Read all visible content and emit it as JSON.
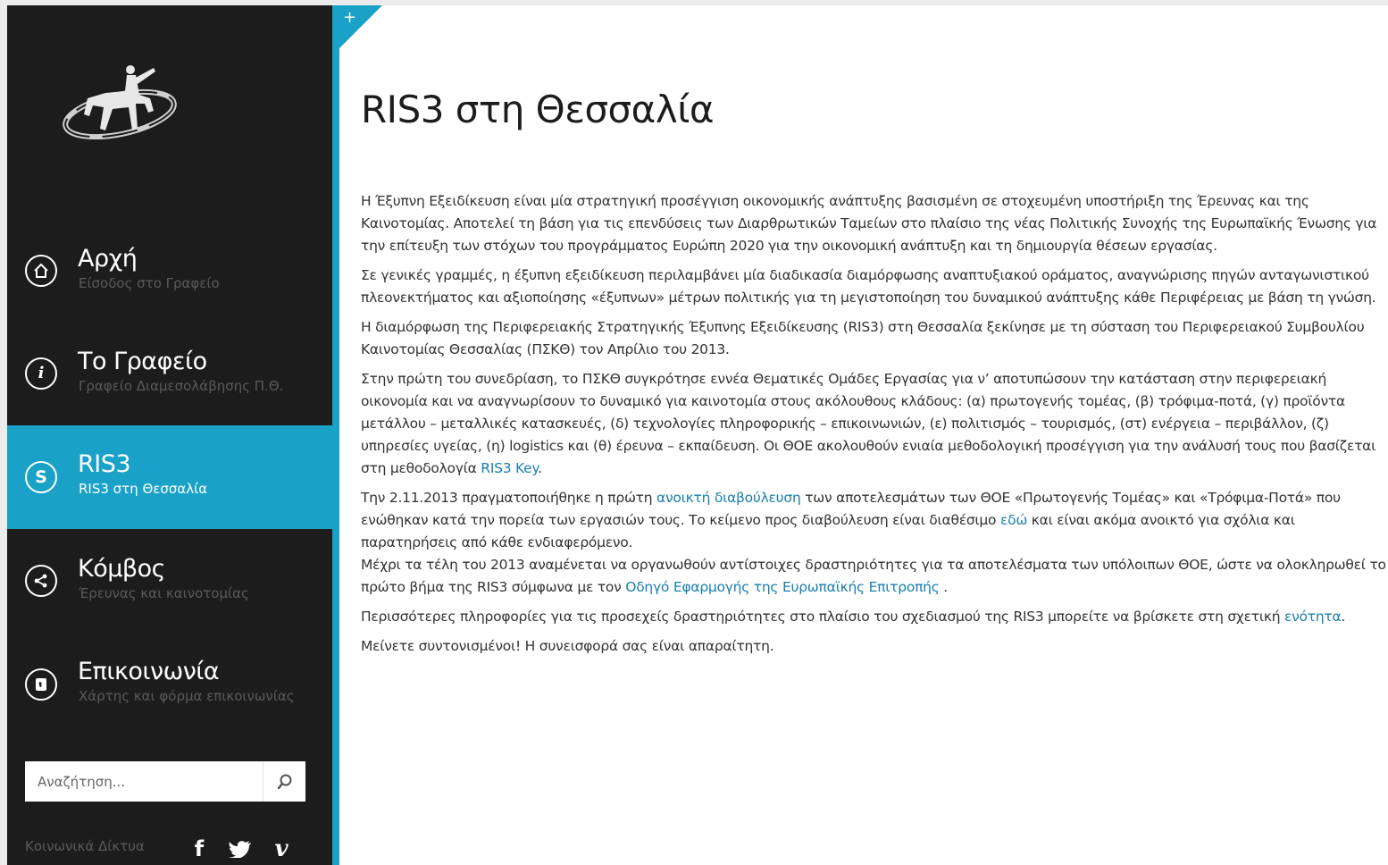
{
  "sidebar": {
    "nav": [
      {
        "title": "Αρχή",
        "subtitle": "Είσοδος στο Γραφείο",
        "icon": "home-icon"
      },
      {
        "title": "Το Γραφείο",
        "subtitle": "Γραφείο Διαμεσολάβησης Π.Θ.",
        "icon": "info-icon"
      },
      {
        "title": "RIS3",
        "subtitle": "RIS3 στη Θεσσαλία",
        "icon": "ris3-icon",
        "active": true
      },
      {
        "title": "Κόμβος",
        "subtitle": "Έρευνας και καινοτομίας",
        "icon": "share-icon"
      },
      {
        "title": "Επικοινωνία",
        "subtitle": "Χάρτης και φόρμα επικοινωνίας",
        "icon": "phone-icon"
      }
    ],
    "search": {
      "placeholder": "Αναζήτηση..."
    },
    "social_label": "Κοινωνικά Δίκτυα",
    "social_icons": [
      "facebook-icon",
      "twitter-icon",
      "vimeo-icon"
    ]
  },
  "content": {
    "corner_symbol": "+",
    "title": "RIS3 στη Θεσσαλία",
    "p1": "Η Έξυπνη Εξειδίκευση είναι μία στρατηγική προσέγγιση οικονομικής ανάπτυξης βασισμένη σε στοχευμένη υποστήριξη της Έρευνας και της Καινοτομίας. Αποτελεί τη βάση για τις επενδύσεις των Διαρθρωτικών Ταμείων στο πλαίσιο της νέας Πολιτικής Συνοχής της Ευρωπαϊκής Ένωσης για την επίτευξη των στόχων του προγράμματος Ευρώπη 2020 για την οικονομική ανάπτυξη και τη δημιουργία θέσεων εργασίας.",
    "p2": "Σε γενικές γραμμές, η έξυπνη εξειδίκευση περιλαμβάνει μία διαδικασία διαμόρφωσης αναπτυξιακού οράματος, αναγνώρισης πηγών ανταγωνιστικού πλεονεκτήματος και αξιοποίησης «έξυπνων» μέτρων πολιτικής για τη μεγιστοποίηση του δυναμικού ανάπτυξης κάθε Περιφέρειας με βάση τη γνώση.",
    "p3": "Η διαμόρφωση της Περιφερειακής Στρατηγικής Έξυπνης Εξειδίκευσης (RIS3) στη Θεσσαλία ξεκίνησε με τη σύσταση του Περιφερειακού Συμβουλίου Καινοτομίας Θεσσαλίας (ΠΣΚΘ) τον Απρίλιο του 2013.",
    "p4_text": "Στην πρώτη του συνεδρίαση, το ΠΣΚΘ συγκρότησε εννέα Θεματικές Ομάδες Εργασίας για ν’ αποτυπώσουν την κατάσταση στην περιφερειακή οικονομία και να αναγνωρίσουν το δυναμικό για καινοτομία στους ακόλουθους κλάδους: (α) πρωτογενής τομέας, (β) τρόφιμα-ποτά, (γ) προϊόντα μετάλλου – μεταλλικές κατασκευές, (δ) τεχνολογίες πληροφορικής – επικοινωνιών, (ε) πολιτισμός – τουρισμός, (στ) ενέργεια – περιβάλλον, (ζ) υπηρεσίες υγείας, (η) logistics και (θ) έρευνα – εκπαίδευση. Οι ΘΟΕ ακολουθούν ενιαία μεθοδολογική προσέγγιση για την ανάλυσή τους που βασίζεται στη μεθοδολογία ",
    "p4_link": "RIS3 Key",
    "p4_end": ".",
    "p5_a": "Την 2.11.2013 πραγματοποιήθηκε η πρώτη ",
    "p5_link1": "ανοικτή διαβούλευση",
    "p5_b": " των αποτελεσμάτων των ΘΟΕ «Πρωτογενής Τομέας» και «Τρόφιμα-Ποτά» που ενώθηκαν κατά την πορεία των εργασιών τους. Το κείμενο προς διαβούλευση είναι διαθέσιμο ",
    "p5_link2": "εδώ",
    "p5_c": " και είναι ακόμα ανοικτό για σχόλια και παρατηρήσεις από κάθε ενδιαφερόμενο.",
    "p5_d": "Μέχρι τα τέλη του 2013 αναμένεται να οργανωθούν αντίστοιχες δραστηριότητες για τα αποτελέσματα των υπόλοιπων ΘΟΕ, ώστε να ολοκληρωθεί το πρώτο βήμα της RIS3 σύμφωνα με τον ",
    "p5_link3": "Οδηγό Εφαρμογής της Ευρωπαϊκής Επιτροπής",
    "p5_e": " .",
    "p6_text": "Περισσότερες πληροφορίες για τις προσεχείς δραστηριότητες στο πλαίσιο του σχεδιασμού της RIS3 μπορείτε να βρίσκετε στη σχετική ",
    "p6_link": "ενότητα",
    "p6_end": ".",
    "p7": "Μείνετε συντονισμένοι! Η συνεισφορά σας είναι απαραίτητη."
  },
  "colors": {
    "accent": "#1aa1c7",
    "sidebar_bg": "#1c1c1d",
    "link": "#1a7fae"
  }
}
